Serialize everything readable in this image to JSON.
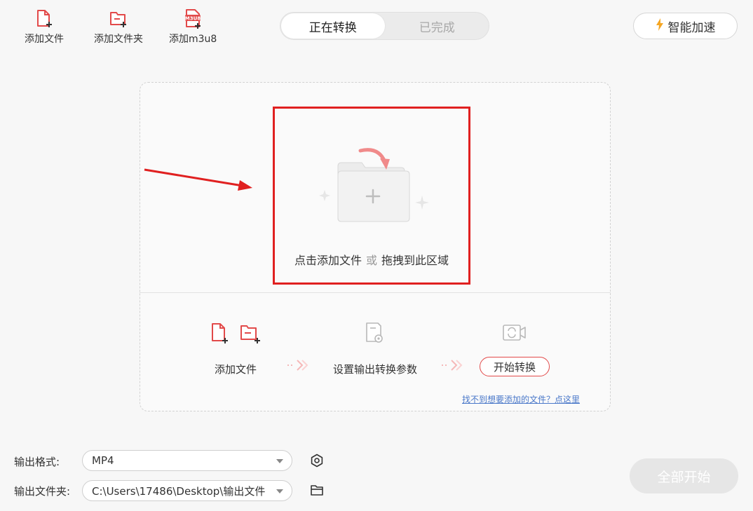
{
  "toolbar": {
    "add_file": "添加文件",
    "add_folder": "添加文件夹",
    "add_m3u8": "添加m3u8",
    "m3u8_badge": "M3U8"
  },
  "tabs": [
    {
      "label": "正在转换",
      "active": true
    },
    {
      "label": "已完成",
      "active": false
    }
  ],
  "accel_label": "智能加速",
  "drop": {
    "prompt_main": "点击添加文件",
    "prompt_or": "或",
    "prompt_drag": "拖拽到此区域"
  },
  "steps": {
    "step1": "添加文件",
    "step2": "设置输出转换参数",
    "step3_button": "开始转换"
  },
  "help_link": "找不到想要添加的文件？点这里",
  "output": {
    "format_label": "输出格式:",
    "format_value": "MP4",
    "folder_label": "输出文件夹:",
    "folder_value": "C:\\Users\\17486\\Desktop\\输出文件"
  },
  "start_all": "全部开始",
  "colors": {
    "accent": "#e24a4a",
    "highlight": "#e02020",
    "link": "#4a78c9"
  }
}
